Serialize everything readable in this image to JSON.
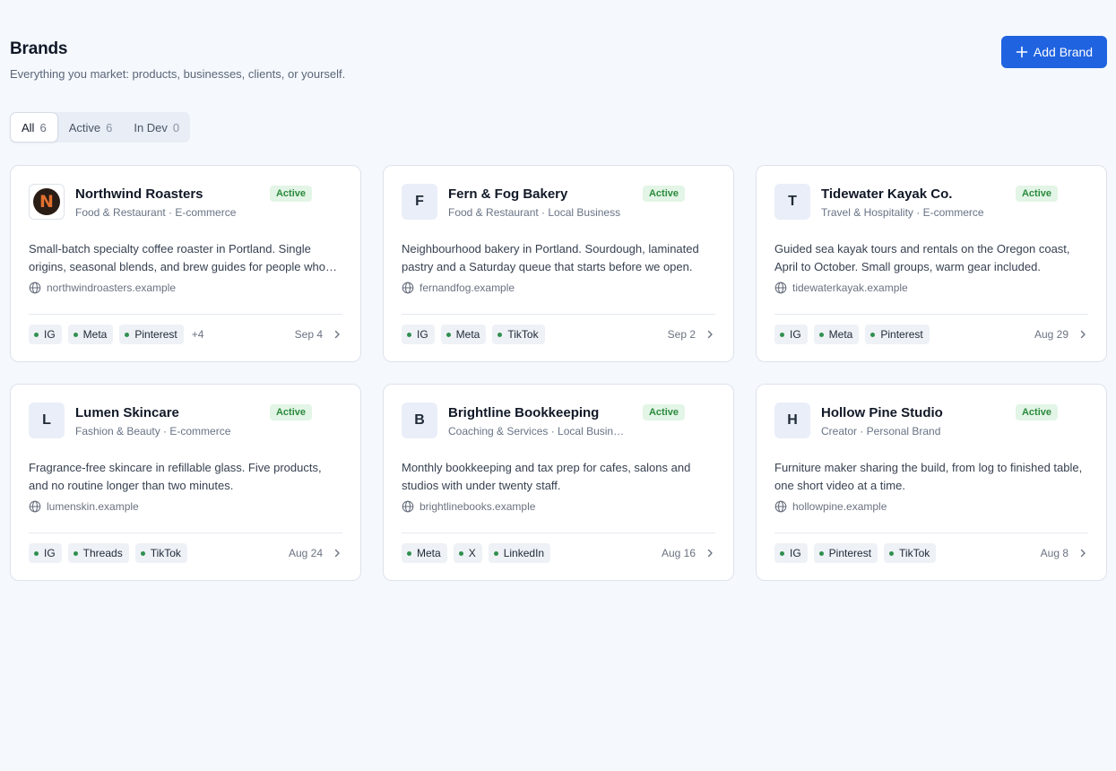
{
  "header": {
    "title": "Brands",
    "subtitle": "Everything you market: products, businesses, clients, or yourself.",
    "add_button_label": "Add Brand"
  },
  "tabs": [
    {
      "label": "All",
      "count": "6"
    },
    {
      "label": "Active",
      "count": "6"
    },
    {
      "label": "In Dev",
      "count": "0"
    }
  ],
  "brands": [
    {
      "name": "Northwind Roasters",
      "initial": "N",
      "has_logo": true,
      "status": "Active",
      "meta": "Food & Restaurant · E-commerce",
      "description": "Small-batch specialty coffee roaster in Portland. Single origins, seasonal blends, and brew guides for people who care about their morning cup.",
      "website": "northwindroasters.example",
      "channels": [
        "IG",
        "Meta",
        "Pinterest"
      ],
      "more": "+4",
      "date": "Sep 4"
    },
    {
      "name": "Fern & Fog Bakery",
      "initial": "F",
      "has_logo": false,
      "status": "Active",
      "meta": "Food & Restaurant · Local Business",
      "description": "Neighbourhood bakery in Portland. Sourdough, laminated pastry and a Saturday queue that starts before we open.",
      "website": "fernandfog.example",
      "channels": [
        "IG",
        "Meta",
        "TikTok"
      ],
      "more": "",
      "date": "Sep 2"
    },
    {
      "name": "Tidewater Kayak Co.",
      "initial": "T",
      "has_logo": false,
      "status": "Active",
      "meta": "Travel & Hospitality · E-commerce",
      "description": "Guided sea kayak tours and rentals on the Oregon coast, April to October. Small groups, warm gear included.",
      "website": "tidewaterkayak.example",
      "channels": [
        "IG",
        "Meta",
        "Pinterest"
      ],
      "more": "",
      "date": "Aug 29"
    },
    {
      "name": "Lumen Skincare",
      "initial": "L",
      "has_logo": false,
      "status": "Active",
      "meta": "Fashion & Beauty · E-commerce",
      "description": "Fragrance-free skincare in refillable glass. Five products, and no routine longer than two minutes.",
      "website": "lumenskin.example",
      "channels": [
        "IG",
        "Threads",
        "TikTok"
      ],
      "more": "",
      "date": "Aug 24"
    },
    {
      "name": "Brightline Bookkeeping",
      "initial": "B",
      "has_logo": false,
      "status": "Active",
      "meta": "Coaching & Services · Local Business",
      "description": "Monthly bookkeeping and tax prep for cafes, salons and studios with under twenty staff.",
      "website": "brightlinebooks.example",
      "channels": [
        "Meta",
        "X",
        "LinkedIn"
      ],
      "more": "",
      "date": "Aug 16"
    },
    {
      "name": "Hollow Pine Studio",
      "initial": "H",
      "has_logo": false,
      "status": "Active",
      "meta": "Creator · Personal Brand",
      "description": "Furniture maker sharing the build, from log to finished table, one short video at a time.",
      "website": "hollowpine.example",
      "channels": [
        "IG",
        "Pinterest",
        "TikTok"
      ],
      "more": "",
      "date": "Aug 8"
    }
  ]
}
